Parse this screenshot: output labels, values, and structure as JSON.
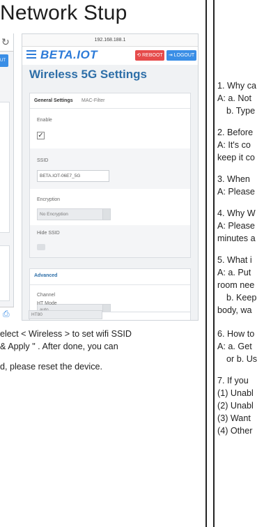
{
  "page": {
    "title": "Network Stup"
  },
  "phone": {
    "url": "192.168.188.1",
    "brand": "BETA.IOT",
    "reboot_label": "⟲ REBOOT",
    "logout_label": "⇥ LOGOUT",
    "screen_title": "Wireless 5G Settings",
    "tabs": {
      "general": "General Settings",
      "mac_filter": "MAC-Filter"
    },
    "general": {
      "enable_label": "Enable",
      "enable_checked": true,
      "ssid_label": "SSID",
      "ssid_value": "BETA.IOT-06E7_5G",
      "encryption_label": "Encryption",
      "encryption_value": "No Encryption",
      "hide_ssid_label": "Hide SSID"
    },
    "advanced": {
      "title": "Advanced",
      "channel_label": "Channel",
      "channel_value": "auto",
      "ht_mode_label": "HT Mode",
      "ht_mode_value": "HT80"
    }
  },
  "left_phone": {
    "button_fragment": "UT"
  },
  "description": {
    "line1": "elect < Wireless > to set wifi SSID",
    "line2": "& Apply \" . After done, you can",
    "line3": "d, please reset the device."
  },
  "faq": {
    "q1": "1. Why ca",
    "a1a": "A: a. Not",
    "a1b": "b. Type",
    "q2": "2. Before",
    "a2a": "A: It's co",
    "a2b": "keep it co",
    "q3": "3. When",
    "a3": "A: Please",
    "q4": "4. Why W",
    "a4a": "A: Please",
    "a4b": "minutes a",
    "q5": "5. What i",
    "a5a": "A: a. Put",
    "a5b": "room nee",
    "a5c": "b. Keep",
    "a5d": "body, wa",
    "q6": "6. How to",
    "a6a": "A: a. Get",
    "a6b": "or b. Us",
    "q7": "7. If you",
    "l1": "(1) Unabl",
    "l2": "(2) Unabl",
    "l3": "(3) Want",
    "l4": "(4) Other"
  }
}
